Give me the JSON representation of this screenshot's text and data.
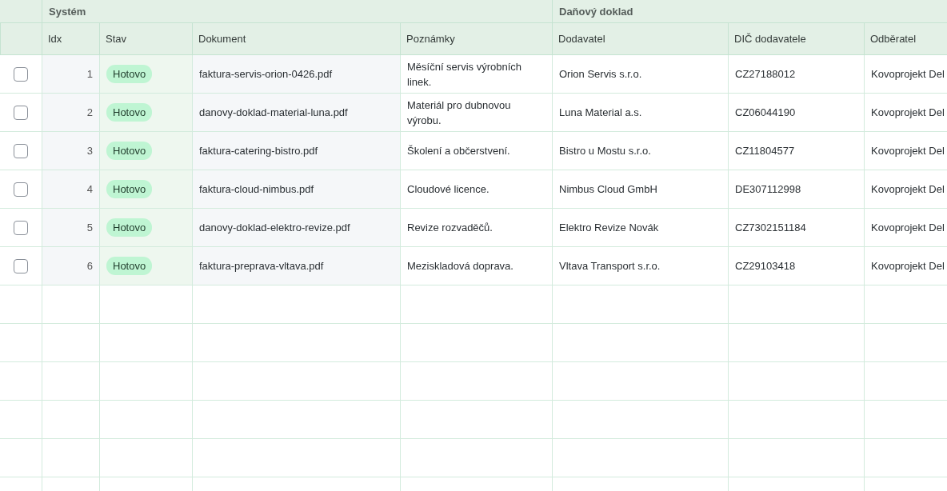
{
  "table": {
    "groups": [
      {
        "label": "Systém"
      },
      {
        "label": "Daňový doklad"
      }
    ],
    "columns": [
      "Idx",
      "Stav",
      "Dokument",
      "Poznámky",
      "Dodavatel",
      "DIČ dodavatele",
      "Odběratel"
    ],
    "rows": [
      {
        "checked": false,
        "idx": "1",
        "status": "Hotovo",
        "document": "faktura-servis-orion-0426.pdf",
        "note": "Měsíční servis výrobních linek.",
        "supplier": "Orion Servis s.r.o.",
        "vat_id": "CZ27188012",
        "customer": "Kovoprojekt Del"
      },
      {
        "checked": false,
        "idx": "2",
        "status": "Hotovo",
        "document": "danovy-doklad-material-luna.pdf",
        "note": "Materiál pro dubnovou výrobu.",
        "supplier": "Luna Material a.s.",
        "vat_id": "CZ06044190",
        "customer": "Kovoprojekt Del"
      },
      {
        "checked": false,
        "idx": "3",
        "status": "Hotovo",
        "document": "faktura-catering-bistro.pdf",
        "note": "Školení a občerstvení.",
        "supplier": "Bistro u Mostu s.r.o.",
        "vat_id": "CZ11804577",
        "customer": "Kovoprojekt Del"
      },
      {
        "checked": false,
        "idx": "4",
        "status": "Hotovo",
        "document": "faktura-cloud-nimbus.pdf",
        "note": "Cloudové licence.",
        "supplier": "Nimbus Cloud GmbH",
        "vat_id": "DE307112998",
        "customer": "Kovoprojekt Del"
      },
      {
        "checked": false,
        "idx": "5",
        "status": "Hotovo",
        "document": "danovy-doklad-elektro-revize.pdf",
        "note": "Revize rozvaděčů.",
        "supplier": "Elektro Revize Novák",
        "vat_id": "CZ7302151184",
        "customer": "Kovoprojekt Del"
      },
      {
        "checked": false,
        "idx": "6",
        "status": "Hotovo",
        "document": "faktura-preprava-vltava.pdf",
        "note": "Meziskladová doprava.",
        "supplier": "Vltava Transport s.r.o.",
        "vat_id": "CZ29103418",
        "customer": "Kovoprojekt Del"
      }
    ]
  }
}
